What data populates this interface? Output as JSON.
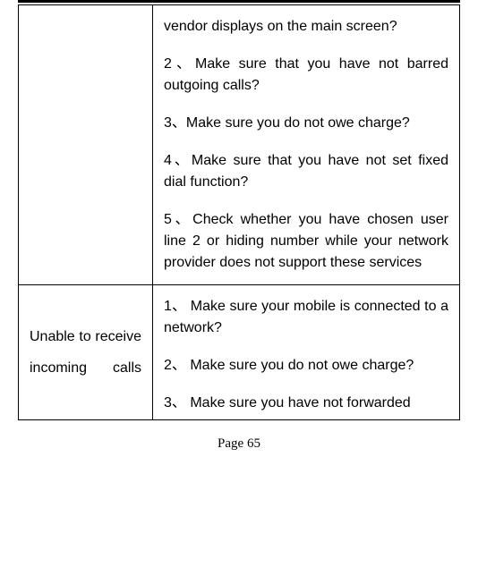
{
  "row1": {
    "left": "",
    "p1": "vendor displays on the main screen?",
    "p2": "2、Make sure that you have not barred outgoing calls?",
    "p3": "3、Make sure you do not owe charge?",
    "p4": "4、Make sure that you have not set fixed dial function?",
    "p5": "5、Check whether you have chosen user line 2 or hiding number while your network provider does not support these services"
  },
  "row2": {
    "left": "Unable to receive incoming calls",
    "p1": "1、 Make sure your mobile is connected to a network?",
    "p2": "2、 Make sure you do not owe charge?",
    "p3": "3、 Make sure you have not forwarded"
  },
  "pagenum": "Page 65"
}
